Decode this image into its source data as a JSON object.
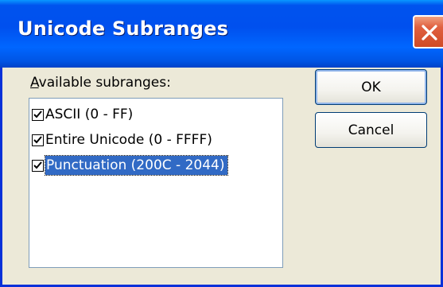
{
  "window": {
    "title": "Unicode Subranges",
    "close_icon": "close-icon"
  },
  "label": {
    "accelerator": "A",
    "rest": "vailable subranges:"
  },
  "list": {
    "items": [
      {
        "label": "ASCII (0 - FF)",
        "checked": true,
        "selected": false
      },
      {
        "label": "Entire Unicode (0 - FFFF)",
        "checked": true,
        "selected": false
      },
      {
        "label": "Punctuation (200C - 2044)",
        "checked": true,
        "selected": true
      }
    ]
  },
  "buttons": {
    "ok_label": "OK",
    "cancel_label": "Cancel"
  },
  "colors": {
    "titlebar": "#0054e3",
    "selection": "#316ac5",
    "dialog_bg": "#ece9d8",
    "close": "#d04a26"
  }
}
